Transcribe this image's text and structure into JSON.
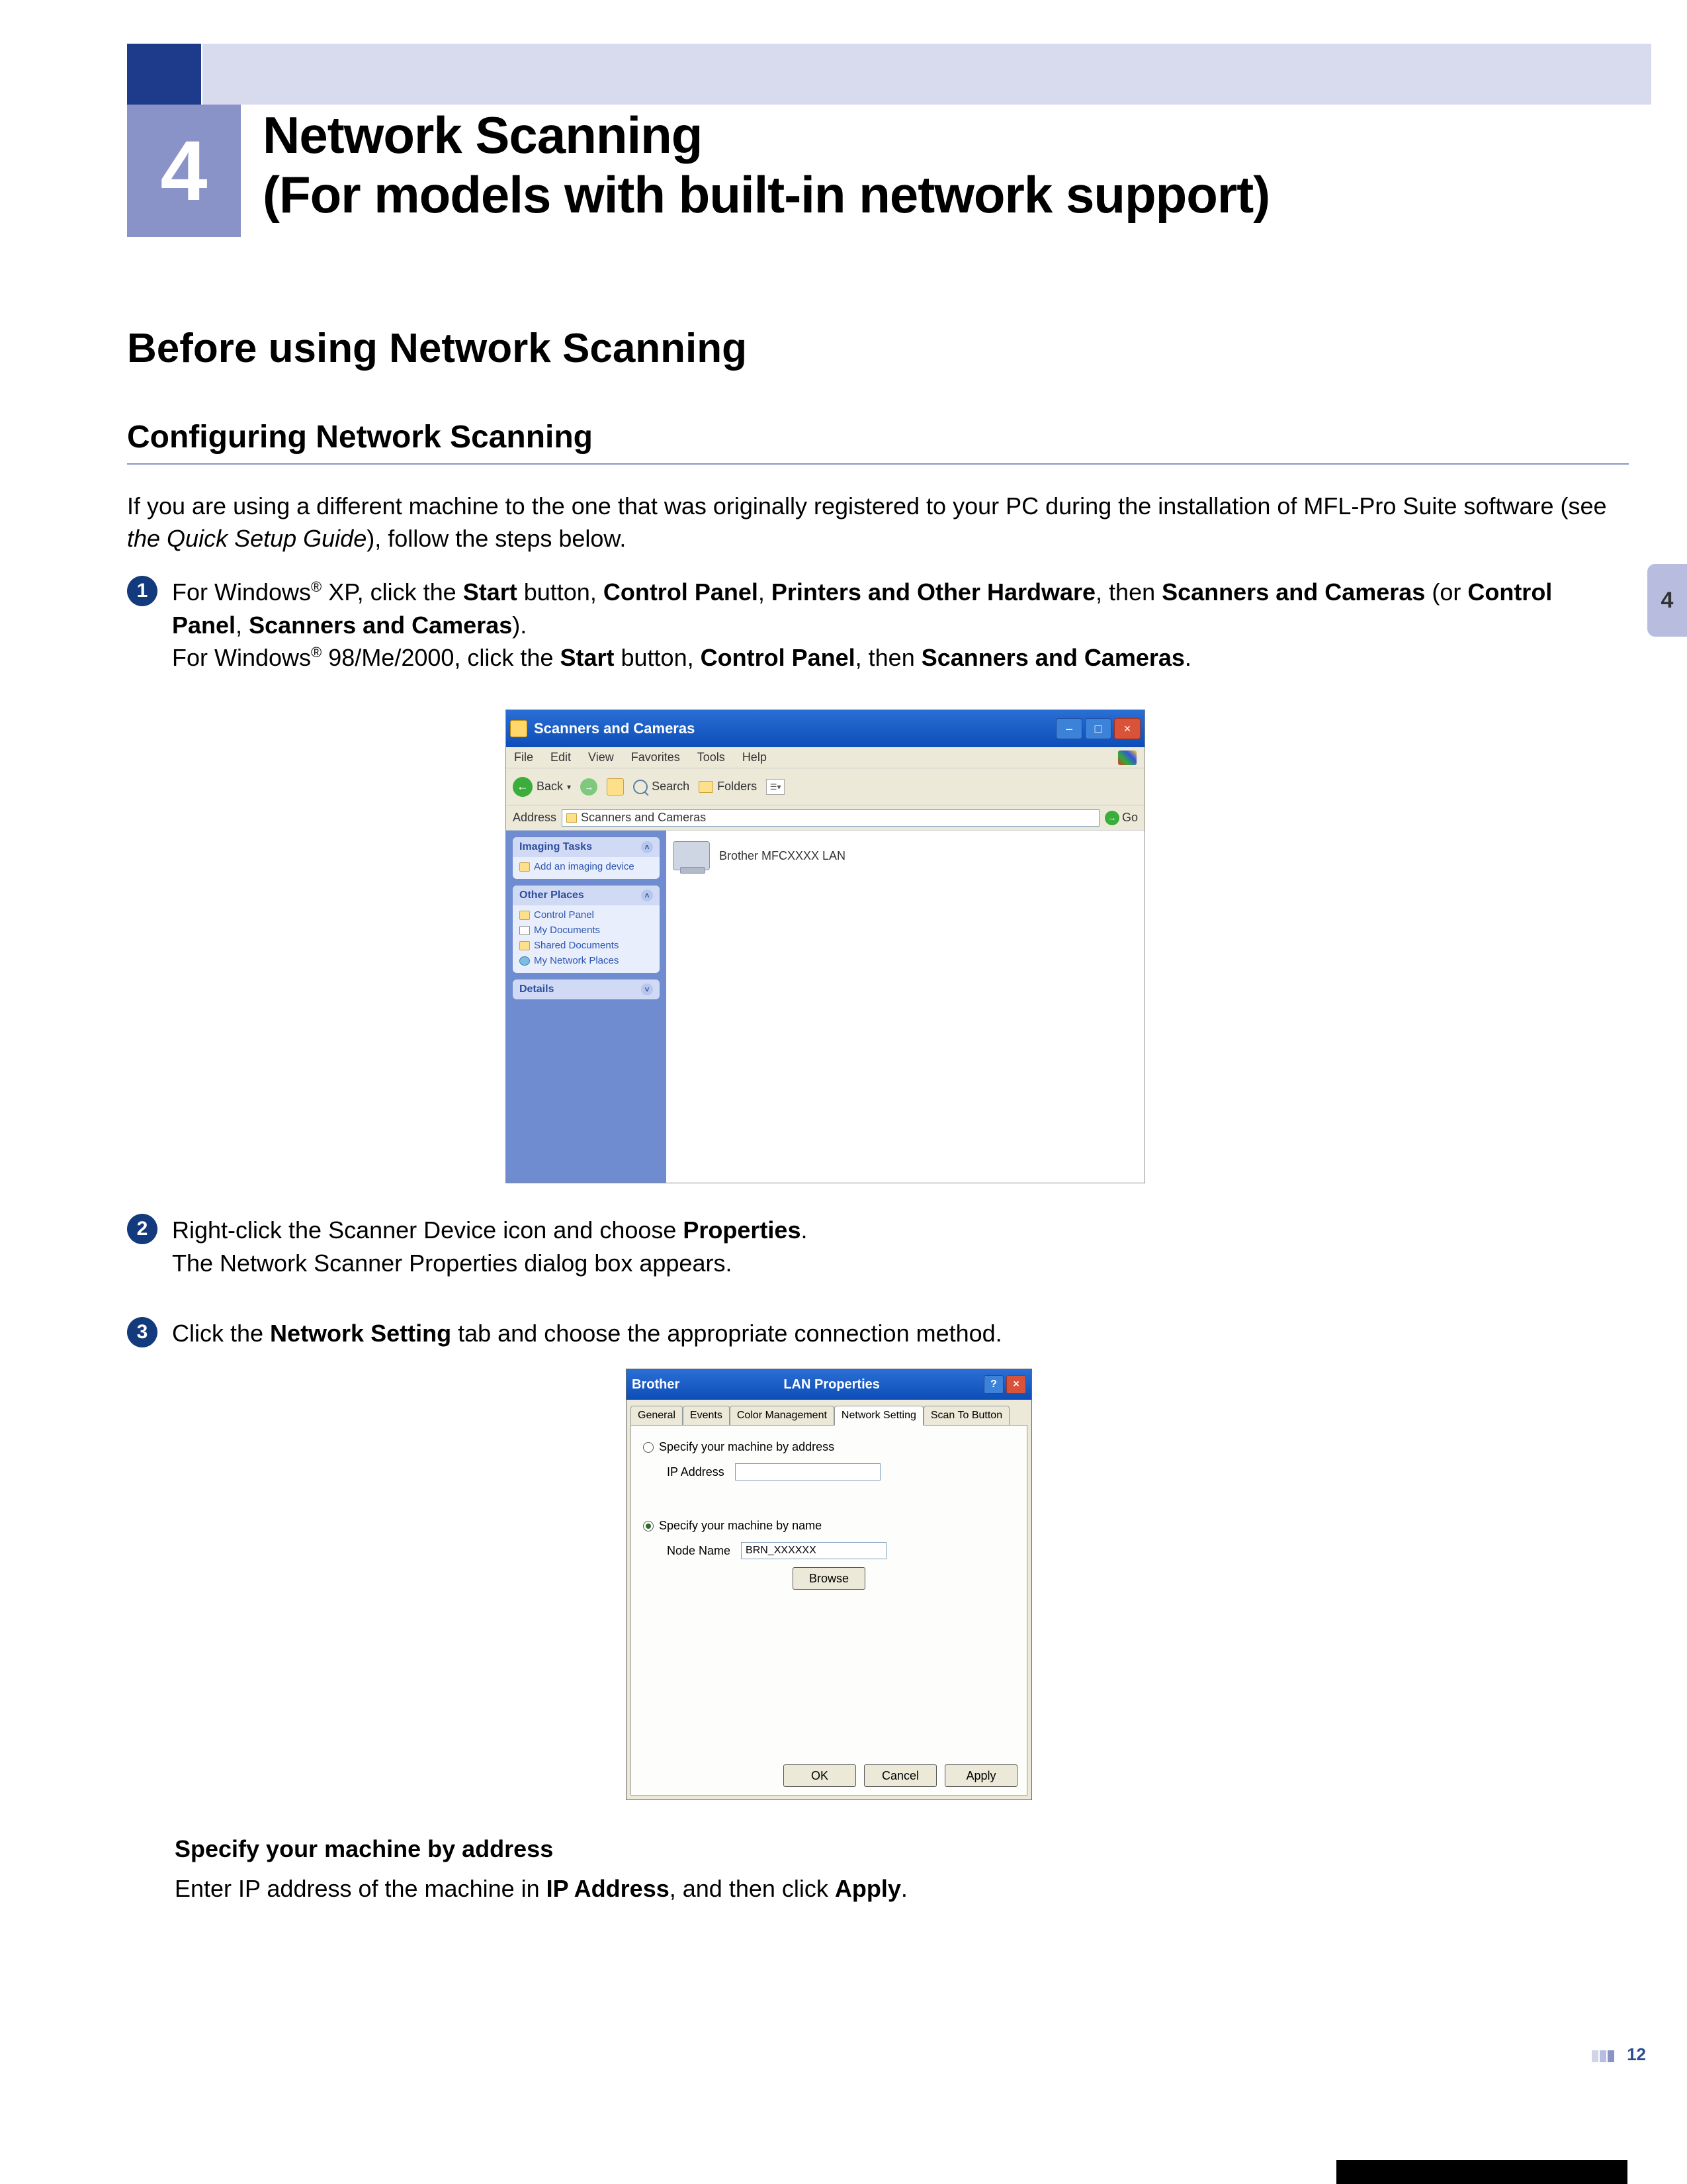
{
  "chapter": {
    "number": "4",
    "title_line1": "Network Scanning",
    "title_line2": "(For models with built-in network support)"
  },
  "side_tab": "4",
  "section": "Before using Network Scanning",
  "subsection": "Configuring Network Scanning",
  "intro": {
    "part1": "If you are using a different machine to the one that was originally registered to your PC during the installation of MFL-Pro Suite software (see ",
    "ital": "the Quick Setup Guide",
    "part2": "), follow the steps below."
  },
  "step1": {
    "num": "1",
    "a1": "For Windows",
    "reg1": "®",
    "a2": " XP, click the ",
    "b_start": "Start",
    "a3": " button, ",
    "b_cp": "Control Panel",
    "c1": ", ",
    "b_poh": "Printers and Other Hardware",
    "c2": ", then ",
    "b_sc": "Scanners and Cameras",
    "c3": " (or ",
    "b_cp2": "Control Panel",
    "c4": ", ",
    "b_sc2": "Scanners and Cameras",
    "c5": ").",
    "line2a": "For Windows",
    "reg2": "®",
    "line2b": " 98/Me/2000, click the ",
    "b_start2": "Start",
    "line2c": " button, ",
    "b_cp3": "Control Panel",
    "line2d": ", then ",
    "b_sc3": "Scanners and Cameras",
    "line2e": "."
  },
  "screenshot1": {
    "title": "Scanners and Cameras",
    "menu": {
      "file": "File",
      "edit": "Edit",
      "view": "View",
      "favorites": "Favorites",
      "tools": "Tools",
      "help": "Help"
    },
    "toolbar": {
      "back": "Back",
      "search": "Search",
      "folders": "Folders"
    },
    "address_label": "Address",
    "address_value": "Scanners and Cameras",
    "go": "Go",
    "panel_tasks": "Imaging Tasks",
    "task1": "Add an imaging device",
    "panel_other": "Other Places",
    "op1": "Control Panel",
    "op2": "My Documents",
    "op3": "Shared Documents",
    "op4": "My Network Places",
    "panel_details": "Details",
    "device": "Brother MFCXXXX LAN"
  },
  "step2": {
    "num": "2",
    "t1": "Right-click the Scanner Device icon and choose ",
    "b_prop": "Properties",
    "t2": ".",
    "line2": "The Network Scanner Properties dialog box appears."
  },
  "step3": {
    "num": "3",
    "t1": "Click the ",
    "b_ns": "Network Setting",
    "t2": " tab and choose the appropriate connection method."
  },
  "screenshot2": {
    "title_left": "Brother",
    "title_mid": "LAN Properties",
    "tabs": {
      "general": "General",
      "events": "Events",
      "color": "Color Management",
      "network": "Network Setting",
      "scan": "Scan To Button"
    },
    "radio1": "Specify your machine by address",
    "label_ip": "IP Address",
    "radio2": "Specify your machine by name",
    "label_node": "Node Name",
    "node_value": "BRN_XXXXXX",
    "browse": "Browse",
    "ok": "OK",
    "cancel": "Cancel",
    "apply": "Apply"
  },
  "spec_heading": "Specify your machine by address",
  "spec": {
    "t1": "Enter IP address of the machine in ",
    "b_ip": "IP Address",
    "t2": ", and then click ",
    "b_apply": "Apply",
    "t3": "."
  },
  "page_number": "12"
}
